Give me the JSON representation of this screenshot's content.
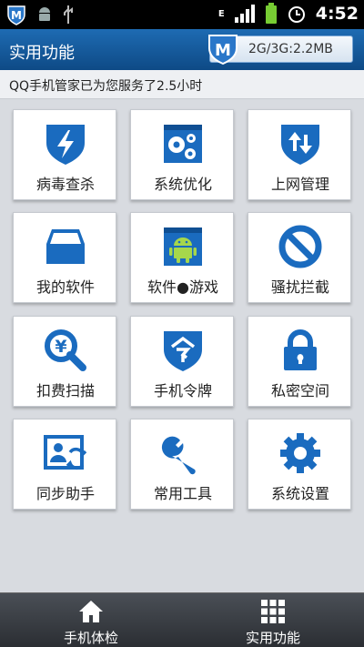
{
  "status_bar": {
    "time": "4:52",
    "network_type": "E",
    "icons": [
      "qq-manager-icon",
      "android-icon",
      "usb-icon",
      "network-e-icon",
      "signal-icon",
      "battery-icon",
      "alarm-icon"
    ]
  },
  "header": {
    "title": "实用功能",
    "traffic": "2G/3G:2.2MB"
  },
  "info": {
    "text": "QQ手机管家已为您服务了2.5小时"
  },
  "tiles": [
    {
      "label": "病毒查杀",
      "icon": "virus-scan-icon"
    },
    {
      "label": "系统优化",
      "icon": "system-optimize-icon"
    },
    {
      "label": "上网管理",
      "icon": "network-manage-icon"
    },
    {
      "label": "我的软件",
      "icon": "my-software-icon"
    },
    {
      "label": "软件●游戏",
      "icon": "software-games-icon"
    },
    {
      "label": "骚扰拦截",
      "icon": "block-icon"
    },
    {
      "label": "扣费扫描",
      "icon": "fee-scan-icon"
    },
    {
      "label": "手机令牌",
      "icon": "phone-token-icon"
    },
    {
      "label": "私密空间",
      "icon": "private-space-icon"
    },
    {
      "label": "同步助手",
      "icon": "sync-assistant-icon"
    },
    {
      "label": "常用工具",
      "icon": "tools-icon"
    },
    {
      "label": "系统设置",
      "icon": "settings-icon"
    }
  ],
  "nav": [
    {
      "label": "手机体检",
      "icon": "home-icon"
    },
    {
      "label": "实用功能",
      "icon": "grid-icon"
    }
  ],
  "colors": {
    "accent": "#1a64ad",
    "icon_blue": "#1a6bbf"
  }
}
